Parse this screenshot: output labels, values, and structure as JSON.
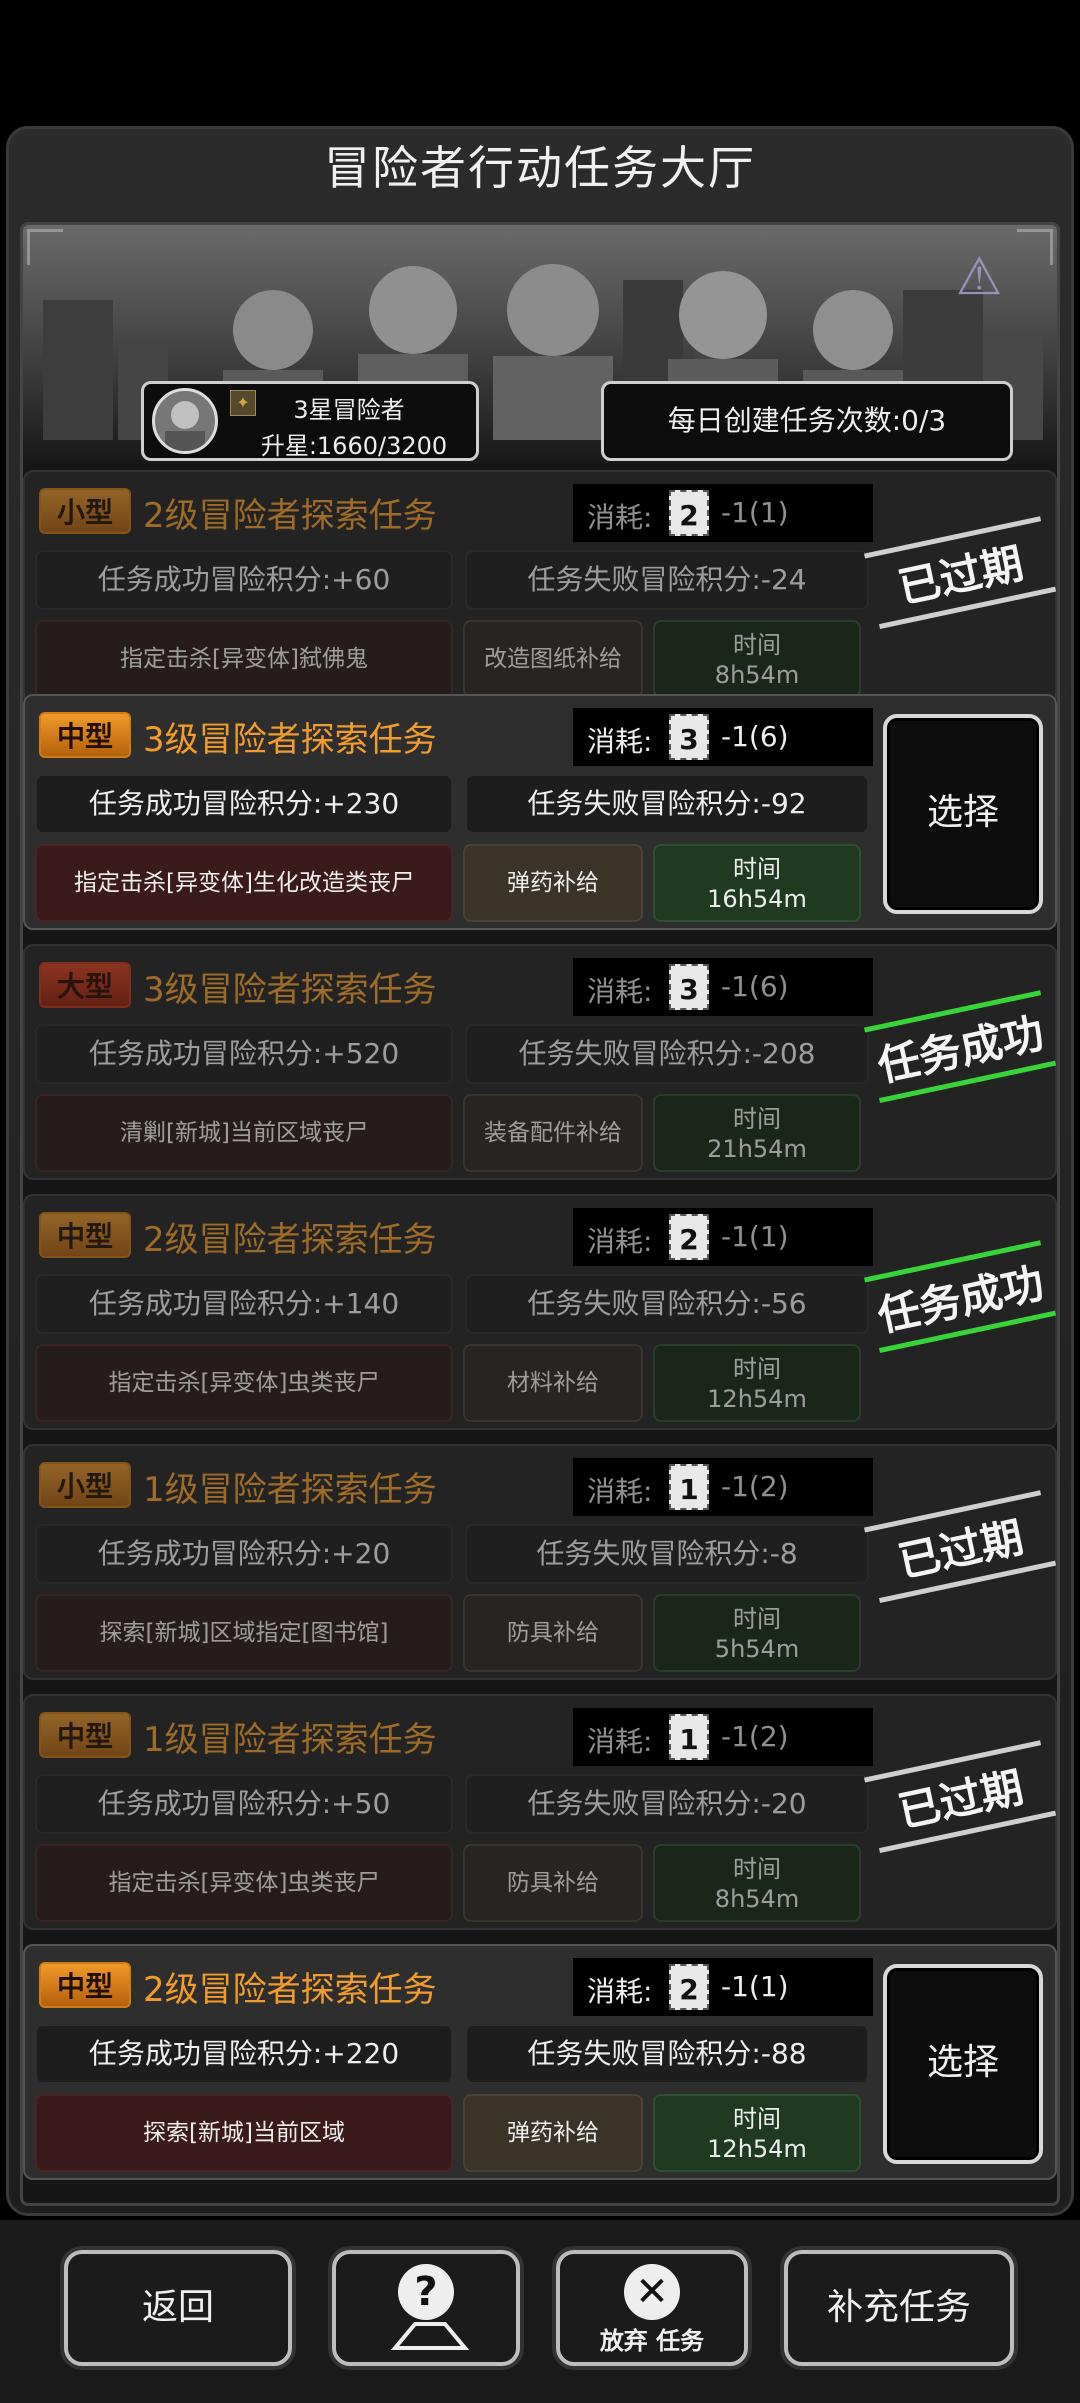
{
  "header": {
    "title": "冒险者行动任务大厅"
  },
  "rank": {
    "name": "3星冒险者",
    "exp": "升星:1660/3200"
  },
  "daily": {
    "label": "每日创建任务次数:0/3"
  },
  "missions": [
    {
      "size": "小型",
      "size_type": "medium",
      "name": "2级冒险者探索任务",
      "cost_label": "消耗:",
      "lv": "2",
      "cost": "-1(1)",
      "win": "任务成功冒险积分:+60",
      "lose": "任务失败冒险积分:-24",
      "target": "指定击杀[异变体]弑佛鬼",
      "reward": "改造图纸补给",
      "time_label": "时间",
      "time": "8h54m",
      "status": "已过期",
      "status_type": "expired"
    },
    {
      "size": "中型",
      "size_type": "medium",
      "name": "3级冒险者探索任务",
      "cost_label": "消耗:",
      "lv": "3",
      "cost": "-1(6)",
      "win": "任务成功冒险积分:+230",
      "lose": "任务失败冒险积分:-92",
      "target": "指定击杀[异变体]生化改造类丧尸",
      "reward": "弹药补给",
      "time_label": "时间",
      "time": "16h54m",
      "status": "选择",
      "status_type": "select"
    },
    {
      "size": "大型",
      "size_type": "large",
      "name": "3级冒险者探索任务",
      "cost_label": "消耗:",
      "lv": "3",
      "cost": "-1(6)",
      "win": "任务成功冒险积分:+520",
      "lose": "任务失败冒险积分:-208",
      "target": "清剿[新城]当前区域丧尸",
      "reward": "装备配件补给",
      "time_label": "时间",
      "time": "21h54m",
      "status": "任务成功",
      "status_type": "success"
    },
    {
      "size": "中型",
      "size_type": "medium",
      "name": "2级冒险者探索任务",
      "cost_label": "消耗:",
      "lv": "2",
      "cost": "-1(1)",
      "win": "任务成功冒险积分:+140",
      "lose": "任务失败冒险积分:-56",
      "target": "指定击杀[异变体]虫类丧尸",
      "reward": "材料补给",
      "time_label": "时间",
      "time": "12h54m",
      "status": "任务成功",
      "status_type": "success"
    },
    {
      "size": "小型",
      "size_type": "medium",
      "name": "1级冒险者探索任务",
      "cost_label": "消耗:",
      "lv": "1",
      "cost": "-1(2)",
      "win": "任务成功冒险积分:+20",
      "lose": "任务失败冒险积分:-8",
      "target": "探索[新城]区域指定[图书馆]",
      "reward": "防具补给",
      "time_label": "时间",
      "time": "5h54m",
      "status": "已过期",
      "status_type": "expired"
    },
    {
      "size": "中型",
      "size_type": "medium",
      "name": "1级冒险者探索任务",
      "cost_label": "消耗:",
      "lv": "1",
      "cost": "-1(2)",
      "win": "任务成功冒险积分:+50",
      "lose": "任务失败冒险积分:-20",
      "target": "指定击杀[异变体]虫类丧尸",
      "reward": "防具补给",
      "time_label": "时间",
      "time": "8h54m",
      "status": "已过期",
      "status_type": "expired"
    },
    {
      "size": "中型",
      "size_type": "medium",
      "name": "2级冒险者探索任务",
      "cost_label": "消耗:",
      "lv": "2",
      "cost": "-1(1)",
      "win": "任务成功冒险积分:+220",
      "lose": "任务失败冒险积分:-88",
      "target": "探索[新城]当前区域",
      "reward": "弹药补给",
      "time_label": "时间",
      "time": "12h54m",
      "status": "选择",
      "status_type": "select"
    }
  ],
  "bottom": {
    "back": "返回",
    "help_icon": "question-icon",
    "abandon": "放弃 任务",
    "abandon_icon": "close-icon",
    "refill": "补充任务"
  }
}
